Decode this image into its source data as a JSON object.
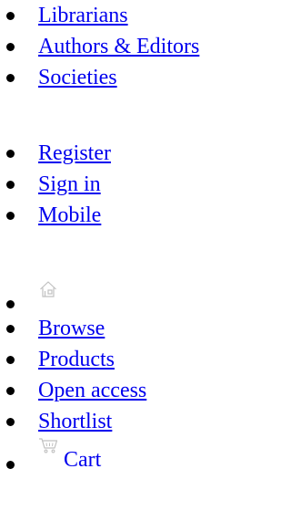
{
  "audience_menu": {
    "items": [
      {
        "label": "Librarians"
      },
      {
        "label": "Authors & Editors"
      },
      {
        "label": "Societies"
      }
    ]
  },
  "account_menu": {
    "items": [
      {
        "label": "Register"
      },
      {
        "label": "Sign in"
      },
      {
        "label": "Mobile"
      }
    ]
  },
  "main_menu": {
    "home_icon": "home-icon",
    "items": [
      {
        "label": "Browse"
      },
      {
        "label": "Products"
      },
      {
        "label": "Open access"
      },
      {
        "label": "Shortlist"
      }
    ],
    "cart": {
      "icon": "cart-icon",
      "label": "Cart"
    }
  },
  "colors": {
    "link": "#0000ee",
    "bullet": "#000000",
    "icon": "#c0c0c0"
  }
}
